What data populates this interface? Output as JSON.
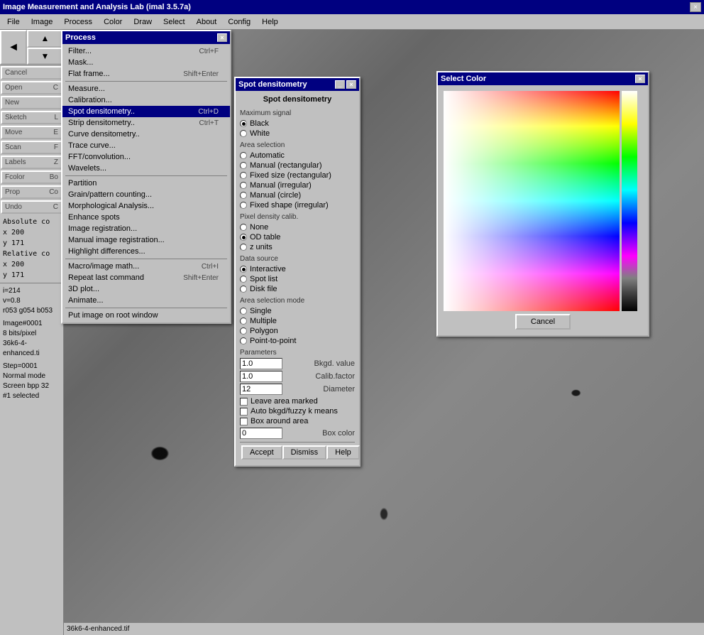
{
  "app": {
    "title": "Image Measurement and Analysis Lab (imal 3.5.7a)",
    "close_label": "×"
  },
  "menubar": {
    "items": [
      {
        "id": "file",
        "label": "File"
      },
      {
        "id": "image",
        "label": "Image"
      },
      {
        "id": "process",
        "label": "Process"
      },
      {
        "id": "color",
        "label": "Color"
      },
      {
        "id": "draw",
        "label": "Draw"
      },
      {
        "id": "select",
        "label": "Select"
      },
      {
        "id": "about",
        "label": "About"
      },
      {
        "id": "config",
        "label": "Config"
      },
      {
        "id": "help",
        "label": "Help"
      }
    ]
  },
  "sidebar": {
    "buttons": [
      {
        "label": "Cancel",
        "shortcut": ""
      },
      {
        "label": "Open",
        "shortcut": "C"
      },
      {
        "label": "New",
        "shortcut": ""
      },
      {
        "label": "Sketch",
        "shortcut": "L"
      },
      {
        "label": "Move",
        "shortcut": "E"
      },
      {
        "label": "Scan",
        "shortcut": "F"
      },
      {
        "label": "Labels",
        "shortcut": "Z"
      },
      {
        "label": "Fcolor",
        "shortcut": "Bo"
      },
      {
        "label": "Prop",
        "shortcut": "Co"
      },
      {
        "label": "Undo",
        "shortcut": "C"
      }
    ]
  },
  "coords": {
    "absolute_label": "Absolute co",
    "x1": "x 200",
    "y1": "y 171",
    "relative_label": "Relative co",
    "x2": "x 200",
    "y2": "y 171"
  },
  "status": {
    "i": "i=214",
    "v": "v=0.8",
    "rgb": "r053 g054 b053",
    "image_info": "Image#0001",
    "bits": "8 bits/pixel",
    "filename": "36k6-4-enhanced.ti",
    "step": "Step=0001",
    "mode": "Normal mode",
    "screen": "Screen bpp 32",
    "selected": "#1 selected"
  },
  "image_filename": "36k6-4-enhanced.tif",
  "process_menu": {
    "title": "Process",
    "items": [
      {
        "label": "Filter...",
        "shortcut": "Ctrl+F"
      },
      {
        "label": "Mask...",
        "shortcut": ""
      },
      {
        "label": "Flat frame...",
        "shortcut": "Shift+Enter"
      },
      {
        "separator": true
      },
      {
        "label": "Measure...",
        "shortcut": ""
      },
      {
        "label": "Calibration...",
        "shortcut": ""
      },
      {
        "label": "Spot densitometry..",
        "shortcut": "Ctrl+D",
        "highlighted": true
      },
      {
        "label": "Strip densitometry..",
        "shortcut": "Ctrl+T"
      },
      {
        "label": "Curve densitometry..",
        "shortcut": ""
      },
      {
        "label": "Trace curve...",
        "shortcut": ""
      },
      {
        "label": "FFT/convolution...",
        "shortcut": ""
      },
      {
        "label": "Wavelets...",
        "shortcut": ""
      },
      {
        "separator": true
      },
      {
        "label": "Partition",
        "shortcut": ""
      },
      {
        "label": "Grain/pattern counting...",
        "shortcut": ""
      },
      {
        "label": "Morphological Analysis...",
        "shortcut": ""
      },
      {
        "label": "Enhance spots",
        "shortcut": ""
      },
      {
        "label": "Image registration...",
        "shortcut": ""
      },
      {
        "label": "Manual image registration...",
        "shortcut": ""
      },
      {
        "label": "Highlight differences...",
        "shortcut": ""
      },
      {
        "separator": true
      },
      {
        "label": "Macro/image math...",
        "shortcut": "Ctrl+I"
      },
      {
        "label": "Repeat last command",
        "shortcut": "Shift+Enter"
      },
      {
        "label": "3D plot...",
        "shortcut": ""
      },
      {
        "label": "Animate...",
        "shortcut": ""
      },
      {
        "separator": true
      },
      {
        "label": "Put image on root window",
        "shortcut": ""
      }
    ]
  },
  "spot_dialog": {
    "title": "Spot densitometry",
    "header": "Spot densitometry",
    "sections": {
      "maximum_signal": {
        "label": "Maximum signal",
        "options": [
          {
            "label": "Black",
            "checked": true
          },
          {
            "label": "White",
            "checked": false
          }
        ]
      },
      "area_selection": {
        "label": "Area selection",
        "options": [
          {
            "label": "Automatic",
            "checked": false
          },
          {
            "label": "Manual (rectangular)",
            "checked": false
          },
          {
            "label": "Fixed size (rectangular)",
            "checked": false
          },
          {
            "label": "Manual (irregular)",
            "checked": false
          },
          {
            "label": "Manual (circle)",
            "checked": false
          },
          {
            "label": "Fixed shape (irregular)",
            "checked": false
          }
        ]
      },
      "pixel_density": {
        "label": "Pixel density calib.",
        "options": [
          {
            "label": "None",
            "checked": false
          },
          {
            "label": "OD table",
            "checked": true
          },
          {
            "label": "z units",
            "checked": false
          }
        ]
      },
      "data_source": {
        "label": "Data source",
        "options": [
          {
            "label": "Interactive",
            "checked": true
          },
          {
            "label": "Spot list",
            "checked": false
          },
          {
            "label": "Disk file",
            "checked": false
          }
        ]
      },
      "area_selection_mode": {
        "label": "Area selection mode",
        "options": [
          {
            "label": "Single",
            "checked": false
          },
          {
            "label": "Multiple",
            "checked": false
          },
          {
            "label": "Polygon",
            "checked": false
          },
          {
            "label": "Point-to-point",
            "checked": false
          }
        ]
      }
    },
    "parameters": {
      "label": "Parameters",
      "bkgd_value": {
        "label": "Bkgd. value",
        "value": "1.0"
      },
      "calib_factor": {
        "label": "Calib.factor",
        "value": "1.0"
      },
      "diameter": {
        "label": "Diameter",
        "value": "12"
      }
    },
    "checkboxes": [
      {
        "label": "Leave area marked",
        "checked": false
      },
      {
        "label": "Auto bkgd/fuzzy k means",
        "checked": false
      },
      {
        "label": "Box around area",
        "checked": false
      }
    ],
    "box_color": {
      "label": "Box color",
      "value": "0"
    },
    "buttons": {
      "accept": "Accept",
      "dismiss": "Dismiss",
      "help": "Help"
    }
  },
  "color_dialog": {
    "title": "Select Color",
    "cancel_label": "Cancel"
  }
}
